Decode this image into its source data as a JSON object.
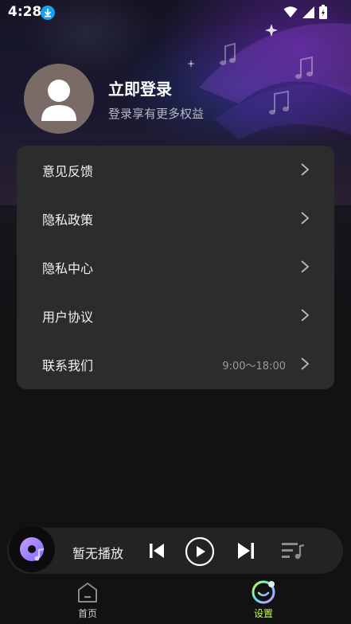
{
  "status_bar": {
    "time": "4:28"
  },
  "profile": {
    "title": "立即登录",
    "subtitle": "登录享有更多权益"
  },
  "menu": {
    "items": [
      {
        "label": "意见反馈",
        "extra": ""
      },
      {
        "label": "隐私政策",
        "extra": ""
      },
      {
        "label": "隐私中心",
        "extra": ""
      },
      {
        "label": "用户协议",
        "extra": ""
      },
      {
        "label": "联系我们",
        "extra": "9:00～18:00"
      }
    ]
  },
  "player": {
    "status": "暂无播放"
  },
  "bottom_nav": {
    "items": [
      {
        "label": "首页",
        "active": false
      },
      {
        "label": "设置",
        "active": true
      }
    ]
  },
  "colors": {
    "card": "#2b2d2d",
    "active_nav": "#c6ff3c",
    "download_badge": "#1aa0f0"
  }
}
